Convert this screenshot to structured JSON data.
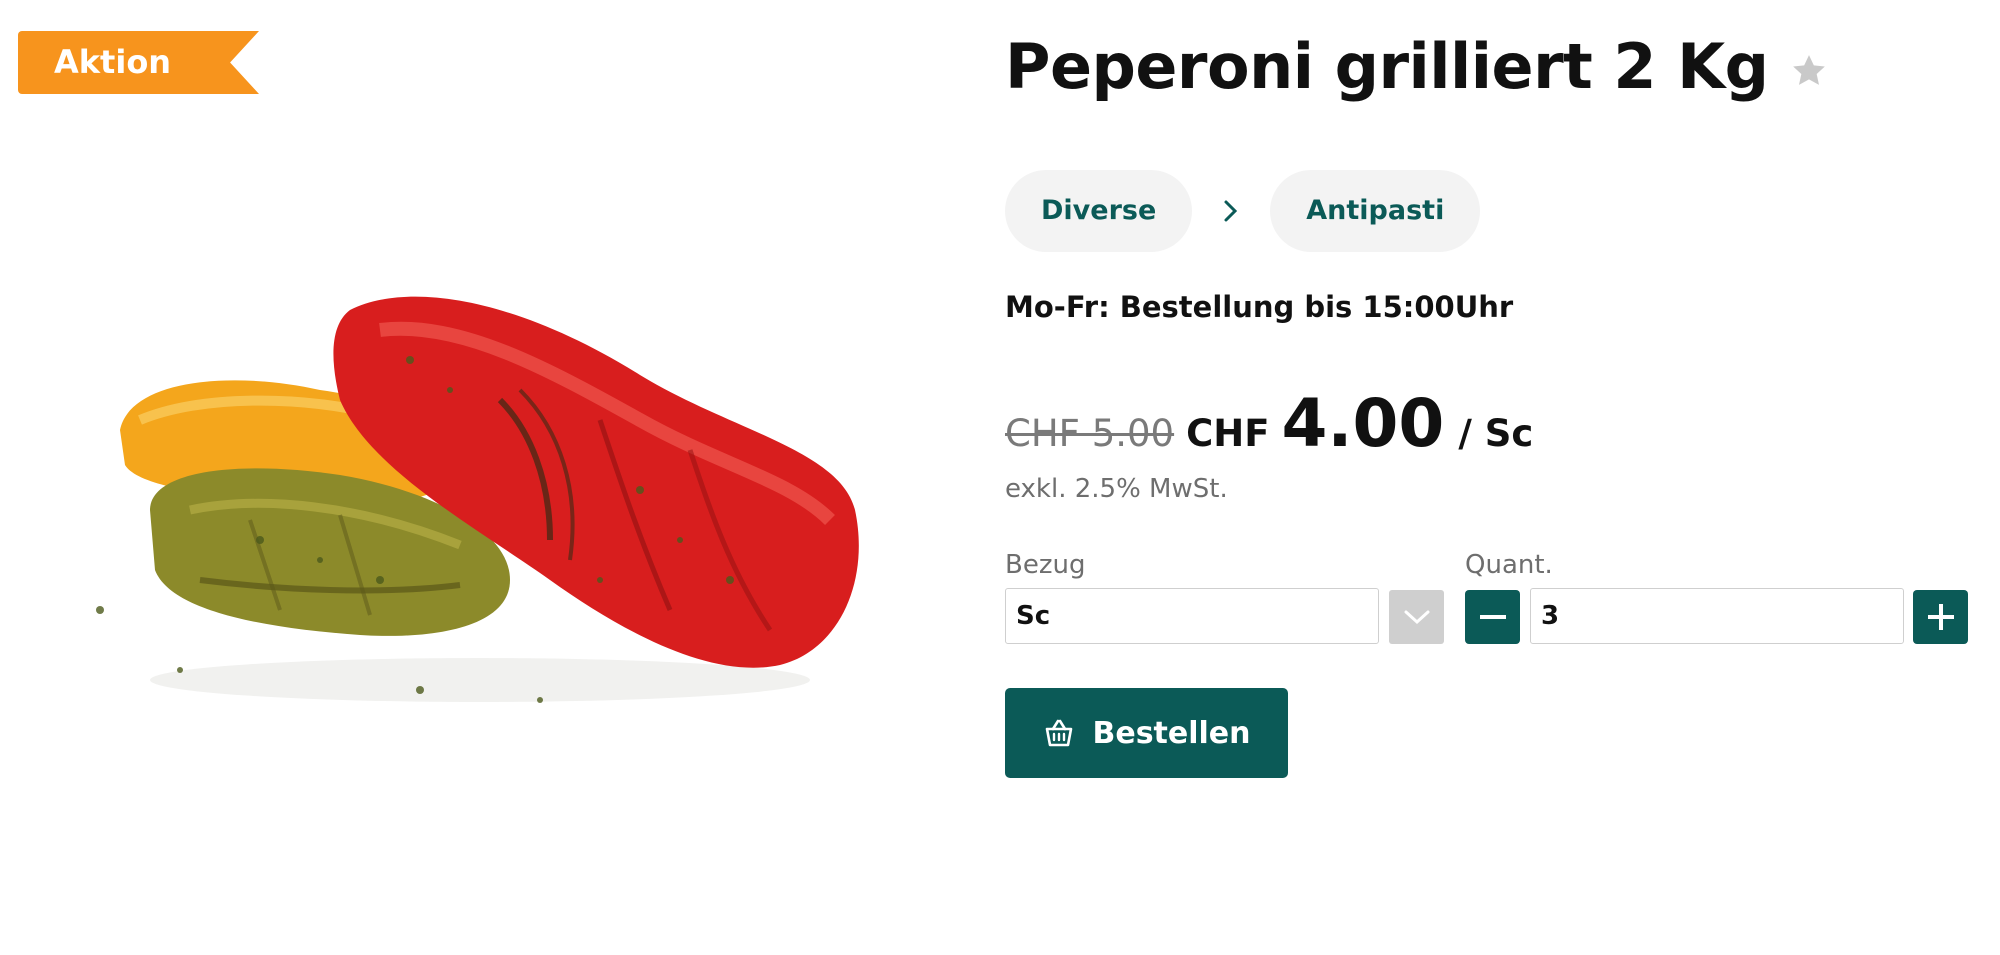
{
  "badge": {
    "label": "Aktion"
  },
  "product": {
    "title": "Peperoni grilliert 2 Kg",
    "image_alt": "grilled peppers"
  },
  "breadcrumb": {
    "items": [
      {
        "label": "Diverse"
      },
      {
        "label": "Antipasti"
      }
    ]
  },
  "order_deadline": "Mo-Fr: Bestellung bis 15:00Uhr",
  "pricing": {
    "old_price": "CHF 5.00",
    "currency": "CHF",
    "price": "4.00",
    "unit": "/ Sc",
    "vat_note": "exkl. 2.5% MwSt."
  },
  "bezug": {
    "label": "Bezug",
    "selected": "Sc"
  },
  "quantity": {
    "label": "Quant.",
    "value": "3"
  },
  "order_button": {
    "label": "Bestellen"
  },
  "colors": {
    "accent": "#0b5a57",
    "badge": "#f7941d",
    "chip_bg": "#f3f3f3"
  },
  "icons": [
    "star-icon",
    "chevron-right-icon",
    "chevron-down-icon",
    "minus-icon",
    "plus-icon",
    "basket-icon"
  ]
}
